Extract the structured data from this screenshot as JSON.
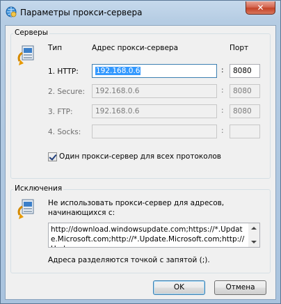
{
  "window": {
    "title": "Параметры прокси-сервера",
    "close_symbol": "✕"
  },
  "servers": {
    "group_label": "Серверы",
    "col_type": "Тип",
    "col_address": "Адрес прокси-сервера",
    "col_port": "Порт",
    "rows": [
      {
        "label": "1. HTTP:",
        "address": "192.168.0.6",
        "port": "8080",
        "enabled": true
      },
      {
        "label": "2. Secure:",
        "address": "192.168.0.6",
        "port": "8080",
        "enabled": false
      },
      {
        "label": "3. FTP:",
        "address": "192.168.0.6",
        "port": "8080",
        "enabled": false
      },
      {
        "label": "4. Socks:",
        "address": "",
        "port": "",
        "enabled": false
      }
    ],
    "colon": ":",
    "same_proxy_label": "Один прокси-сервер для всех протоколов",
    "same_proxy_checked": true
  },
  "exceptions": {
    "group_label": "Исключения",
    "description": "Не использовать прокси-сервер для адресов, начинающихся с:",
    "value": "http://download.windowsupdate.com;https://*.Update.Microsoft.com;http://*.Update.Microsoft.com;http://Upd",
    "hint": "Адреса разделяются точкой с запятой (;)."
  },
  "buttons": {
    "ok": "OK",
    "cancel": "Отмена"
  }
}
